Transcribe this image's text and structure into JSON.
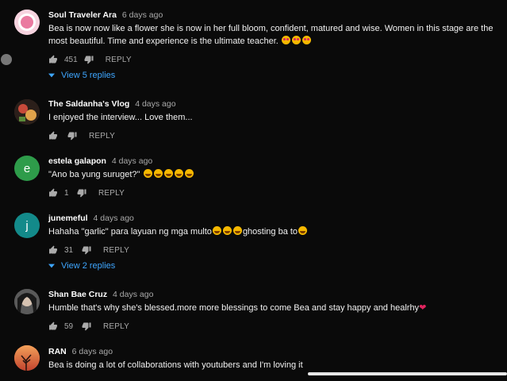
{
  "comments": [
    {
      "author": "Soul Traveler Ara",
      "time": "6 days ago",
      "text": "Bea is now now like a flower she is now in her full bloom, confident,  matured and wise. Women in this stage are the most beautiful. Time and experience is the ultimate teacher.",
      "likes": "451",
      "reply_label": "REPLY",
      "view_replies": "View 5 replies"
    },
    {
      "author": "The Saldanha's Vlog",
      "time": "4 days ago",
      "text": "I enjoyed the interview... Love them...",
      "likes": "",
      "reply_label": "REPLY"
    },
    {
      "author": "estela galapon",
      "time": "4 days ago",
      "text": "\"Ano ba yung suruget?\"",
      "likes": "1",
      "reply_label": "REPLY",
      "avatar_letter": "e",
      "avatar_color": "#2e9c4a"
    },
    {
      "author": "junemeful",
      "time": "4 days ago",
      "text_before": "Hahaha \"garlic\" para layuan ng mga multo",
      "text_after": "ghosting ba to",
      "likes": "31",
      "reply_label": "REPLY",
      "view_replies": "View 2 replies",
      "avatar_letter": "j",
      "avatar_color": "#138a8a"
    },
    {
      "author": "Shan Bae Cruz",
      "time": "4 days ago",
      "text": "Humble that's why she's blessed.more more blessings to come Bea and stay happy and healrhy",
      "likes": "59",
      "reply_label": "REPLY"
    },
    {
      "author": "RAN",
      "time": "6 days ago",
      "text": "Bea is doing a lot of collaborations with youtubers and I'm loving it",
      "likes": "",
      "reply_label": "REPLY"
    }
  ],
  "colors": {
    "background": "#0a0a0a",
    "link_blue": "#3ea6ff",
    "secondary_text": "#aaaaaa"
  },
  "icons": [
    "thumb-up-icon",
    "thumb-down-icon",
    "caret-down-icon",
    "laughing-emoji-icon",
    "heart-eyes-emoji-icon",
    "red-heart-icon"
  ]
}
